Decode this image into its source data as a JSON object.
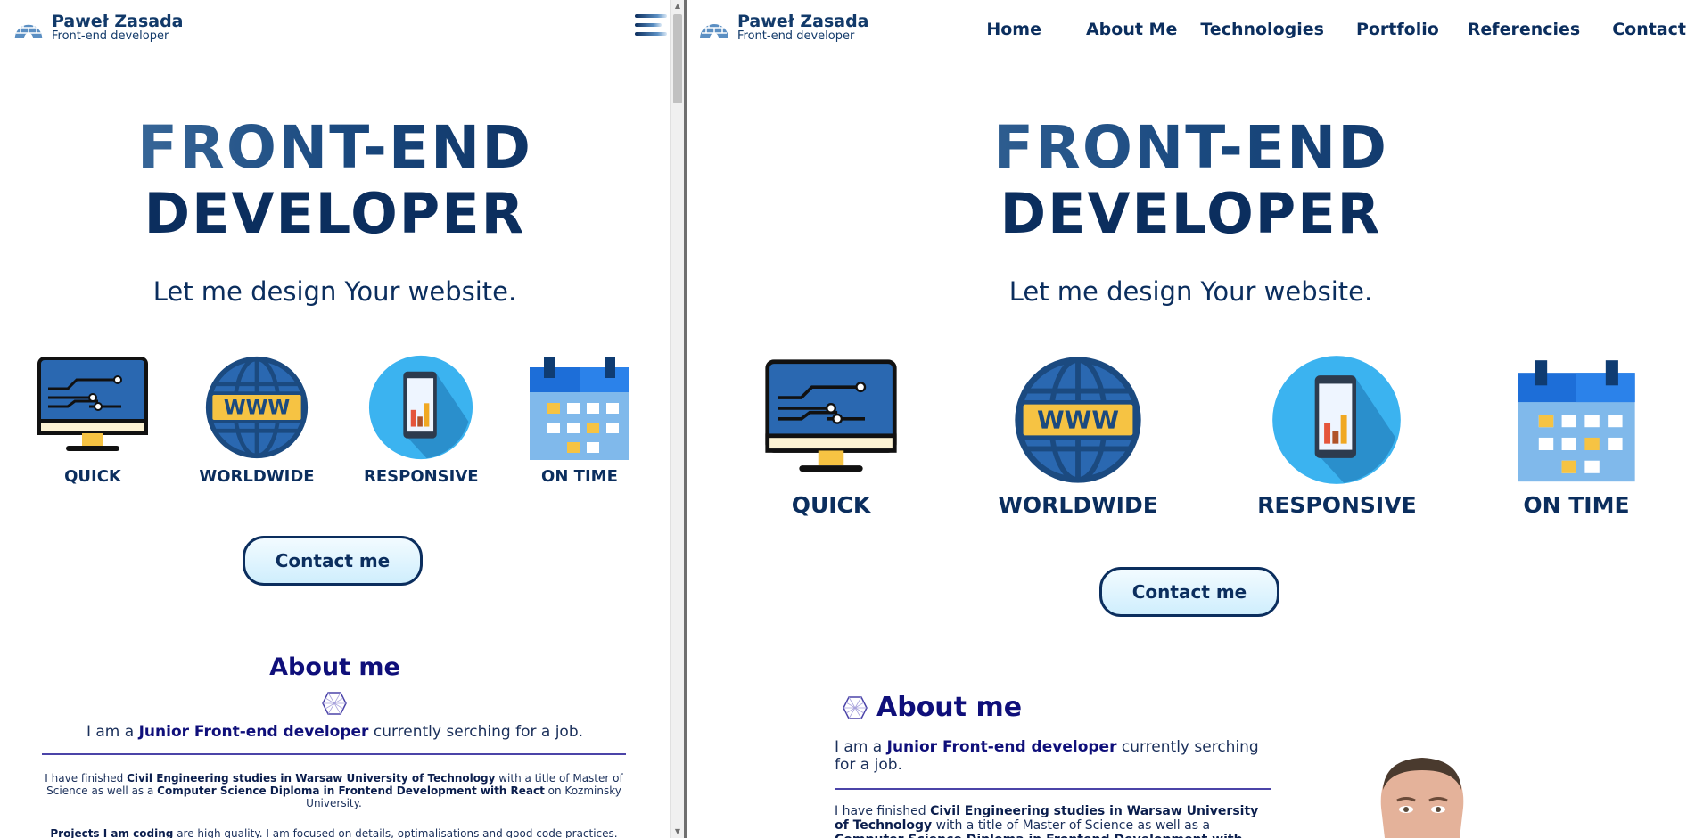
{
  "site": {
    "name": "Paweł Zasada",
    "role": "Front-end developer"
  },
  "nav": [
    "Home",
    "About Me",
    "Technologies",
    "Portfolio",
    "Referencies",
    "Contact"
  ],
  "hero": {
    "line1": "FRONT-END",
    "line2": "DEVELOPER",
    "subtitle": "Let me design Your website."
  },
  "features": [
    {
      "label": "QUICK",
      "icon": "monitor-icon"
    },
    {
      "label": "WORLDWIDE",
      "icon": "globe-www-icon"
    },
    {
      "label": "RESPONSIVE",
      "icon": "phone-chart-icon"
    },
    {
      "label": "ON TIME",
      "icon": "calendar-icon"
    }
  ],
  "contact_button": "Contact me",
  "about": {
    "title": "About me",
    "intro_pre": "I am a ",
    "intro_bold": "Junior Front-end developer",
    "intro_post": " currently serching for a job.",
    "study_pre": "I have finished ",
    "study_bold1": "Civil Engineering studies in Warsaw University of Technology",
    "study_mid": " with a title of Master of Science as well as a ",
    "study_bold2": "Computer Science Diploma in Frontend Development with React",
    "study_post": " on Kozminsky University.",
    "projects_bold": "Projects I am coding",
    "projects_post": " are high quality. I am focused on details, optimalisations and good code practices."
  },
  "colors": {
    "navy": "#0b2e5e",
    "purple": "#0f0f7a",
    "button_bg": "#cfeefd"
  }
}
